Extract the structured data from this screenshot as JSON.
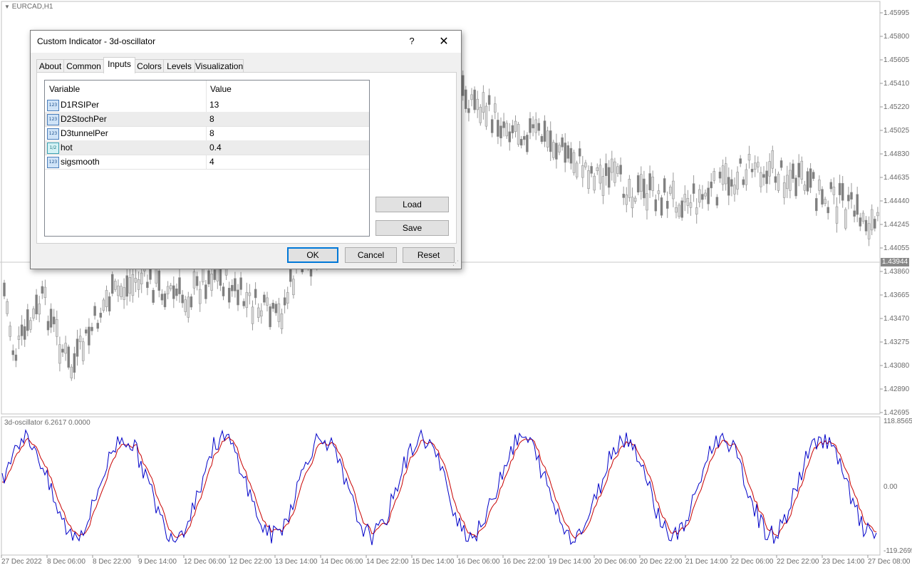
{
  "chart": {
    "symbol_label": "EURCAD,H1",
    "oscillator_label": "3d-oscillator 6.2617 0.0000",
    "current_price": "1.43944",
    "price_levels": [
      "1.45995",
      "1.45800",
      "1.45605",
      "1.45410",
      "1.45220",
      "1.45025",
      "1.44830",
      "1.44635",
      "1.44440",
      "1.44245",
      "1.44055",
      "1.43860",
      "1.43665",
      "1.43470",
      "1.43275",
      "1.43080",
      "1.42890",
      "1.42695"
    ],
    "osc_levels": [
      "118.8565",
      "0.00",
      "-119.2695"
    ],
    "time_labels": [
      "27 Dec 2022",
      "8 Dec 06:00",
      "8 Dec 22:00",
      "9 Dec 14:00",
      "12 Dec 06:00",
      "12 Dec 22:00",
      "13 Dec 14:00",
      "14 Dec 06:00",
      "14 Dec 22:00",
      "15 Dec 14:00",
      "16 Dec 06:00",
      "16 Dec 22:00",
      "19 Dec 14:00",
      "20 Dec 06:00",
      "20 Dec 22:00",
      "21 Dec 14:00",
      "22 Dec 06:00",
      "22 Dec 22:00",
      "23 Dec 14:00",
      "27 Dec 08:00"
    ],
    "colors": {
      "candle": "#7f7f7f",
      "osc_main": "#0000c8",
      "osc_signal": "#c80000",
      "grid": "#c0c0c0"
    }
  },
  "dialog": {
    "title": "Custom Indicator - 3d-oscillator",
    "help_label": "?",
    "close_icon": "close-icon",
    "tabs": [
      "About",
      "Common",
      "Inputs",
      "Colors",
      "Levels",
      "Visualization"
    ],
    "active_tab": "Inputs",
    "table": {
      "headers": [
        "Variable",
        "Value"
      ],
      "rows": [
        {
          "icon": "123",
          "variable": "D1RSIPer",
          "value": "13"
        },
        {
          "icon": "123",
          "variable": "D2StochPer",
          "value": "8"
        },
        {
          "icon": "123",
          "variable": "D3tunnelPer",
          "value": "8"
        },
        {
          "icon": "1/2",
          "variable": "hot",
          "value": "0.4"
        },
        {
          "icon": "123",
          "variable": "sigsmooth",
          "value": "4"
        }
      ]
    },
    "buttons": {
      "load": "Load",
      "save": "Save",
      "ok": "OK",
      "cancel": "Cancel",
      "reset": "Reset"
    }
  }
}
